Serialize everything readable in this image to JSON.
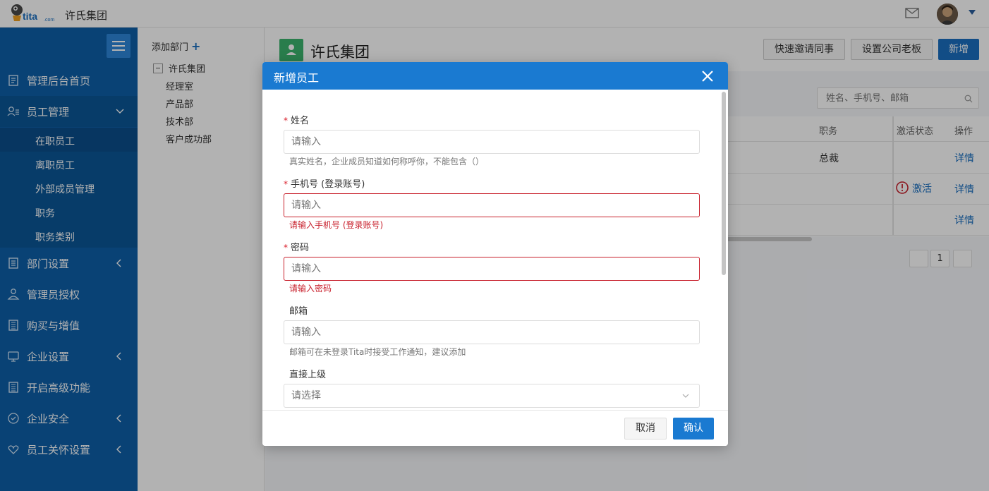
{
  "topbar": {
    "logo_text": "tita.com",
    "company_name": "许氏集团",
    "icons": [
      "mail-icon",
      "avatar",
      "caret-down-icon"
    ]
  },
  "sidebar": {
    "items": [
      {
        "label": "管理后台首页",
        "icon": "document-icon"
      },
      {
        "label": "员工管理",
        "icon": "user-list-icon"
      },
      {
        "label": "部门设置",
        "icon": "file-icon"
      },
      {
        "label": "管理员授权",
        "icon": "admin-icon"
      },
      {
        "label": "购买与增值",
        "icon": "book-icon"
      },
      {
        "label": "企业设置",
        "icon": "settings-icon"
      },
      {
        "label": "开启高级功能",
        "icon": "feature-icon"
      },
      {
        "label": "企业安全",
        "icon": "security-icon"
      },
      {
        "label": "员工关怀设置",
        "icon": "care-icon"
      }
    ],
    "sub_items": [
      {
        "label": "在职员工",
        "active": true
      },
      {
        "label": "离职员工"
      },
      {
        "label": "外部成员管理"
      },
      {
        "label": "职务"
      },
      {
        "label": "职务类别"
      }
    ],
    "colors": {
      "bg": "#0d5fa8",
      "active": "#0b4e8c"
    }
  },
  "depts": {
    "add_label": "添加部门",
    "root": "许氏集团",
    "children": [
      "经理室",
      "产品部",
      "技术部",
      "客户成功部"
    ]
  },
  "main": {
    "title": "许氏集团",
    "buttons": {
      "invite": "快速邀请同事",
      "set_boss": "设置公司老板",
      "add": "新增"
    },
    "search_placeholder": "姓名、手机号、邮箱",
    "table": {
      "headers": {
        "title": "职务",
        "status": "激活状态",
        "action": "操作"
      },
      "rows": [
        {
          "title": "总裁",
          "status": "",
          "action": "详情"
        },
        {
          "title": "",
          "status": "激活",
          "action": "详情"
        },
        {
          "title": "",
          "status": "",
          "action": "详情"
        }
      ]
    },
    "pagination": {
      "current": "1"
    }
  },
  "modal": {
    "title": "新增员工",
    "fields": {
      "name": {
        "label": "姓名",
        "required": "*",
        "placeholder": "请输入",
        "help": "真实姓名，企业成员知道如何称呼你，不能包含（）"
      },
      "phone": {
        "label": "手机号 (登录账号)",
        "required": "*",
        "placeholder": "请输入",
        "error": "请输入手机号 (登录账号)"
      },
      "password": {
        "label": "密码",
        "required": "*",
        "placeholder": "请输入",
        "error": "请输入密码"
      },
      "email": {
        "label": "邮箱",
        "placeholder": "请输入",
        "help": "邮箱可在未登录Tita时接受工作通知，建议添加"
      },
      "manager": {
        "label": "直接上级",
        "placeholder": "请选择"
      }
    },
    "footer": {
      "cancel": "取消",
      "confirm": "确认"
    },
    "colors": {
      "header": "#1a7ad1",
      "error": "#c8202c",
      "required": "#d9202c"
    }
  }
}
